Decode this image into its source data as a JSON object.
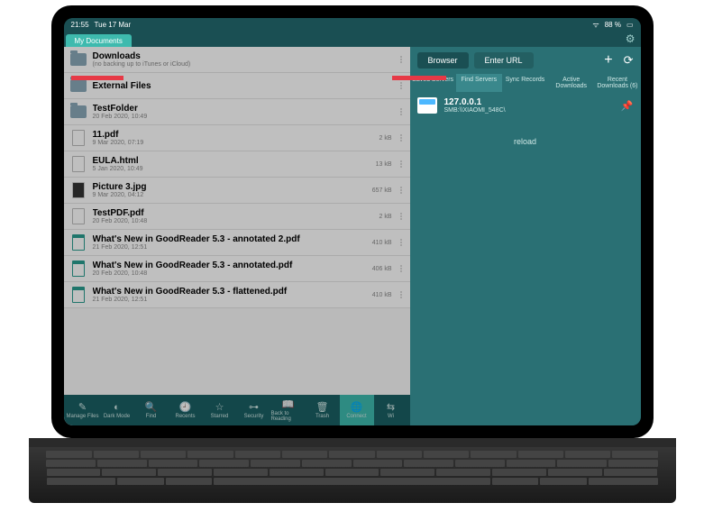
{
  "status": {
    "time": "21:55",
    "date": "Tue 17 Mar",
    "battery": "88 %"
  },
  "tab": {
    "label": "My Documents"
  },
  "files": [
    {
      "name": "Downloads",
      "meta": "(no backing up to iTunes or iCloud)",
      "kind": "folder",
      "size": ""
    },
    {
      "name": "External Files",
      "meta": "",
      "kind": "folder",
      "size": ""
    },
    {
      "name": "TestFolder",
      "meta": "20 Feb 2020, 10:49",
      "kind": "folder",
      "size": ""
    },
    {
      "name": "11.pdf",
      "meta": "9 Mar 2020, 07:19",
      "kind": "pdf",
      "size": "2 kB"
    },
    {
      "name": "EULA.html",
      "meta": "5 Jan 2020, 10:49",
      "kind": "doc",
      "size": "13 kB"
    },
    {
      "name": "Picture 3.jpg",
      "meta": "9 Mar 2020, 04:12",
      "kind": "pic",
      "size": "657 kB"
    },
    {
      "name": "TestPDF.pdf",
      "meta": "20 Feb 2020, 10:48",
      "kind": "pdf",
      "size": "2 kB"
    },
    {
      "name": "What's New in GoodReader 5.3 - annotated 2.pdf",
      "meta": "21 Feb 2020, 12:51",
      "kind": "green",
      "size": "410 kB"
    },
    {
      "name": "What's New in GoodReader 5.3 - annotated.pdf",
      "meta": "20 Feb 2020, 10:48",
      "kind": "green",
      "size": "406 kB"
    },
    {
      "name": "What's New in GoodReader 5.3 - flattened.pdf",
      "meta": "21 Feb 2020, 12:51",
      "kind": "green",
      "size": "410 kB"
    }
  ],
  "toolbar": [
    {
      "label": "Manage Files",
      "icon": "✎"
    },
    {
      "label": "Dark Mode",
      "icon": "◐"
    },
    {
      "label": "Find",
      "icon": "🔍"
    },
    {
      "label": "Recents",
      "icon": "🕘"
    },
    {
      "label": "Starred",
      "icon": "☆"
    },
    {
      "label": "Security",
      "icon": "⊶"
    },
    {
      "label": "Back to Reading",
      "icon": "📖"
    },
    {
      "label": "Trash",
      "icon": "🗑"
    },
    {
      "label": "Connect",
      "icon": "🌐"
    },
    {
      "label": "Wi",
      "icon": "⇆"
    }
  ],
  "right": {
    "browser": "Browser",
    "enter_url": "Enter URL",
    "tabs": [
      "Saved Servers",
      "Find Servers",
      "Sync Records",
      "Active Downloads",
      "Recent Downloads (6)"
    ],
    "server": {
      "name": "127.0.0.1",
      "sub": "SMB:\\\\XIAOMI_548C\\"
    },
    "reload": "reload"
  }
}
